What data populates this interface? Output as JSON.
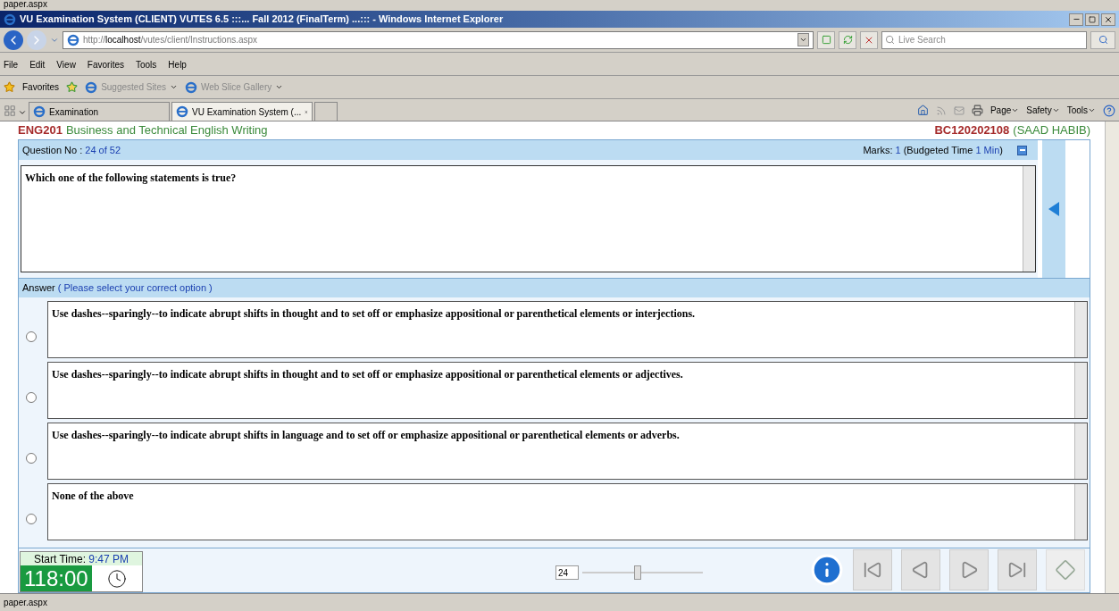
{
  "background_status": "paper.aspx",
  "window": {
    "title": "VU Examination System (CLIENT) VUTES 6.5 :::... Fall 2012 (FinalTerm) ...::: - Windows Internet Explorer"
  },
  "address_bar": {
    "url_prefix": "http://",
    "url_host": "localhost",
    "url_path": "/vutes/client/Instructions.aspx",
    "search_placeholder": "Live Search"
  },
  "menu": [
    "File",
    "Edit",
    "View",
    "Favorites",
    "Tools",
    "Help"
  ],
  "favorites_bar": {
    "label": "Favorites",
    "links": [
      "Suggested Sites",
      "Web Slice Gallery"
    ]
  },
  "tabs": [
    {
      "label": "Examination",
      "selected": false
    },
    {
      "label": "VU Examination System (...",
      "selected": true
    }
  ],
  "command_bar": [
    "Page",
    "Safety",
    "Tools"
  ],
  "exam": {
    "course_code": "ENG201",
    "course_name": "Business and Technical English Writing",
    "student_id": "BC120202108",
    "student_name": "(SAAD HABIB)",
    "question_label": "Question No :",
    "question_number": "24 of 52",
    "marks_label": "Marks:",
    "marks": "1",
    "budget_label": "(Budgeted Time",
    "budget_value": "1 Min",
    "budget_close": ")",
    "question": "Which one of the following statements is true?",
    "answer_label": "Answer",
    "answer_hint": "( Please select your correct option )",
    "options": [
      {
        "text": "Use dashes--sparingly--to indicate abrupt shifts in thought and to set off or emphasize appositional or parenthetical elements or interjections.",
        "selected": false
      },
      {
        "text": "Use dashes--sparingly--to indicate abrupt shifts in thought and to set off or emphasize appositional or parenthetical elements or adjectives.",
        "selected": false
      },
      {
        "text": "Use dashes--sparingly--to indicate abrupt shifts in language and to set off or emphasize appositional or parenthetical elements or adverbs.",
        "selected": false
      },
      {
        "text": "None of the above",
        "selected": false
      }
    ],
    "start_time_label": "Start Time:",
    "start_time": "9:47 PM",
    "timer": "118:00",
    "jump": {
      "value": "24",
      "level": 0.46
    }
  },
  "status_bar": "paper.aspx"
}
